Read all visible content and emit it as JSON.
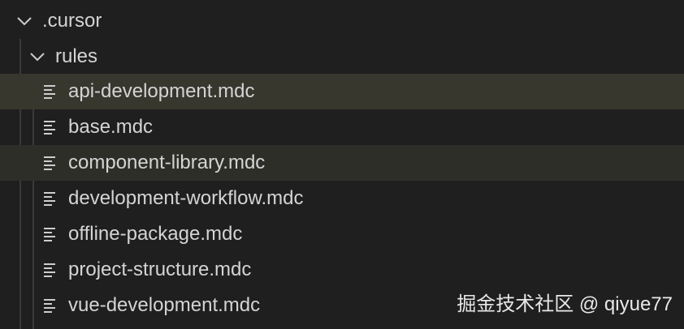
{
  "tree": {
    "root": {
      "label": ".cursor",
      "expanded": true,
      "icon": "chevron-down-icon"
    },
    "folder": {
      "label": "rules",
      "expanded": true,
      "icon": "chevron-down-icon"
    },
    "files": [
      {
        "label": "api-development.mdc",
        "icon": "file-lines-icon",
        "state": "selected"
      },
      {
        "label": "base.mdc",
        "icon": "file-lines-icon",
        "state": "normal"
      },
      {
        "label": "component-library.mdc",
        "icon": "file-lines-icon",
        "state": "hovered"
      },
      {
        "label": "development-workflow.mdc",
        "icon": "file-lines-icon",
        "state": "normal"
      },
      {
        "label": "offline-package.mdc",
        "icon": "file-lines-icon",
        "state": "normal"
      },
      {
        "label": "project-structure.mdc",
        "icon": "file-lines-icon",
        "state": "normal"
      },
      {
        "label": "vue-development.mdc",
        "icon": "file-lines-icon",
        "state": "normal"
      }
    ]
  },
  "watermark": {
    "text": "掘金技术社区 @ qiyue77"
  },
  "colors": {
    "background": "#1f1f1f",
    "selected_row": "#37372e",
    "hovered_row": "#2e2e29",
    "text": "#d4d4d4",
    "indent_guide": "#3a3a3a"
  }
}
